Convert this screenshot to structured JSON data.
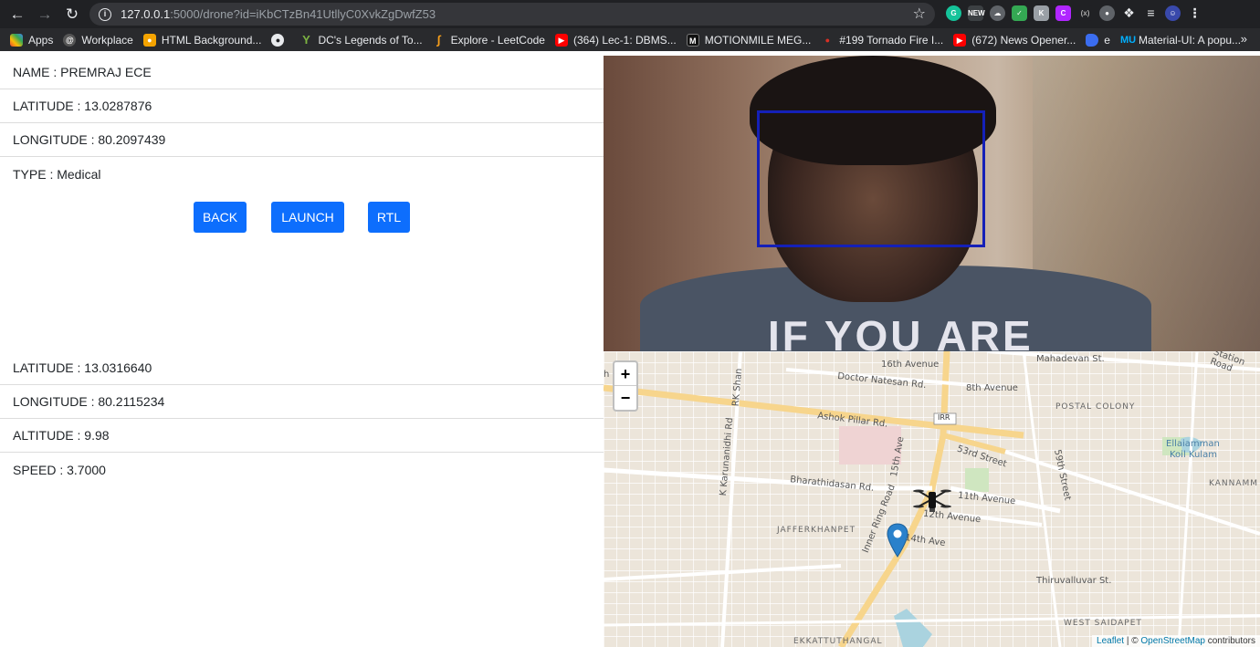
{
  "browser": {
    "url_host": "127.0.0.1",
    "url_rest": ":5000/drone?id=iKbCTzBn41UtllyC0XvkZgDwfZ53",
    "bookmarks": [
      {
        "label": "Apps",
        "icon": "apps-grid-icon",
        "color": "#ea4335"
      },
      {
        "label": "Workplace",
        "icon": "workplace-icon",
        "color": "#555555"
      },
      {
        "label": "HTML Background...",
        "icon": "html-bg-icon",
        "color": "#f4a300"
      },
      {
        "label": "",
        "icon": "globe-icon",
        "color": "#5f6368"
      },
      {
        "label": "DC's Legends of To...",
        "icon": "yify-icon",
        "color": "#7cb342"
      },
      {
        "label": "Explore - LeetCode",
        "icon": "leetcode-icon",
        "color": "#f89f1b"
      },
      {
        "label": "(364) Lec-1: DBMS...",
        "icon": "youtube-icon",
        "color": "#ff0000"
      },
      {
        "label": "MOTIONMILE MEG...",
        "icon": "motionmile-icon",
        "color": "#111111"
      },
      {
        "label": "#199 Tornado Fire I...",
        "icon": "tornado-icon",
        "color": "#d93025"
      },
      {
        "label": "(672) News Opener...",
        "icon": "youtube-icon",
        "color": "#ff0000"
      },
      {
        "label": "e",
        "icon": "bookmark-e-icon",
        "color": "#3b6df0"
      },
      {
        "label": "Material-UI: A popu...",
        "icon": "material-ui-icon",
        "color": "#00b0ff"
      }
    ],
    "more_bookmarks": "»"
  },
  "drone_info": {
    "name": "NAME : PREMRAJ ECE",
    "latitude": "LATITUDE : 13.0287876",
    "longitude": "LONGITUDE : 80.2097439",
    "type": "TYPE : Medical"
  },
  "actions": {
    "back": "BACK",
    "launch": "LAUNCH",
    "rtl": "RTL"
  },
  "telemetry": {
    "latitude": "LATITUDE : 13.0316640",
    "longitude": "LONGITUDE : 80.2115234",
    "altitude": "ALTITUDE : 9.98",
    "speed": "SPEED : 3.7000"
  },
  "camera": {
    "shirt_text": "IF YOU ARE"
  },
  "map": {
    "zoom_in": "+",
    "zoom_out": "−",
    "attribution_leaflet": "Leaflet",
    "attribution_sep": " | © ",
    "attribution_osm": "OpenStreetMap",
    "attribution_tail": " contributors",
    "labels": {
      "mahadevan": "Mahadevan St.",
      "ave16": "16th Avenue",
      "natesan": "Doctor Natesan Rd.",
      "ave8": "8th Avenue",
      "postal": "POSTAL COLONY",
      "ashok": "Ashok Pillar Rd.",
      "irr": "IRR",
      "st53": "53rd Street",
      "st59": "59th Street",
      "ellaiamman": "Ellaiamman",
      "koil": "Koil Kulam",
      "kannamm": "KANNAMM",
      "bharathidasan": "Bharathidasan Rd.",
      "ave11": "11th Avenue",
      "ave12": "12th Avenue",
      "jafferkhanpet": "JAFFERKHANPET",
      "ave14": "14th Ave",
      "ave15": "15th Ave",
      "innerring": "Inner Ring Road",
      "karunanidhi": "K Karunanidhi Rd",
      "rksh": "RK Shan",
      "thiruvalluvar": "Thiruvalluvar St.",
      "westsaidapet": "WEST SAIDAPET",
      "ekkatu": "EKKATTUTHANGAL",
      "station": "Station Road",
      "lh": "h St"
    }
  }
}
